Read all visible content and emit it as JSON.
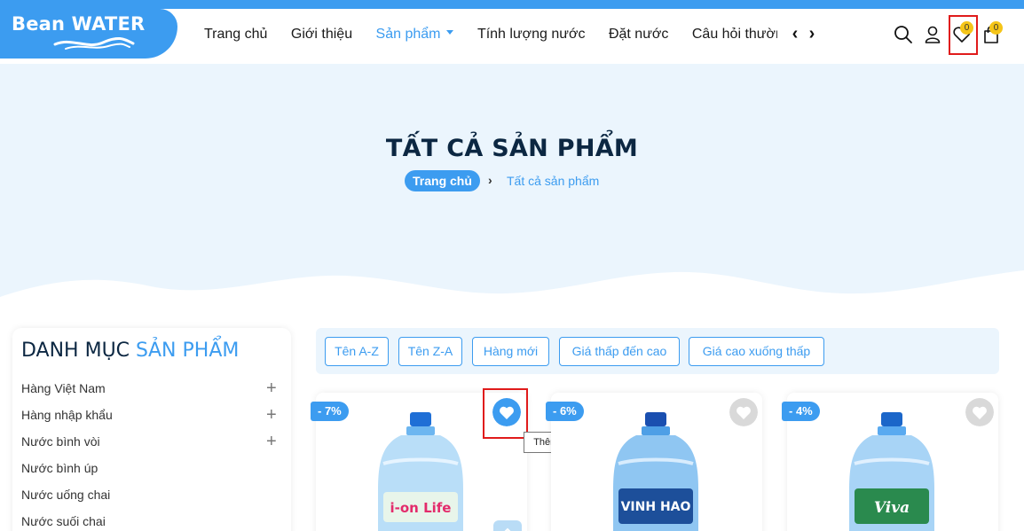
{
  "colors": {
    "accent": "#3c9cf0",
    "badge": "#f5c518",
    "highlight": "#e01b1b",
    "banner_bg": "#ebf5fd"
  },
  "logo": {
    "text": "Bean WATER"
  },
  "nav": {
    "items": [
      "Trang chủ",
      "Giới thiệu",
      "Sản phẩm",
      "Tính lượng nước",
      "Đặt nước",
      "Câu hỏi thường gặp"
    ],
    "active": "Sản phẩm",
    "prev_icon": "chevron-left-icon",
    "next_icon": "chevron-right-icon"
  },
  "header_icons": {
    "search": "search-icon",
    "account": "user-icon",
    "wishlist": "heart-icon",
    "wishlist_count": "0",
    "cart": "shopping-bag-icon",
    "cart_count": "0"
  },
  "banner": {
    "title": "TẤT CẢ SẢN PHẨM",
    "breadcrumb_home": "Trang chủ",
    "breadcrumb_sep": "›",
    "breadcrumb_current": "Tất cả sản phẩm"
  },
  "sidebar": {
    "title": "DANH MỤC",
    "title_accent": "SẢN PHẨM",
    "categories": [
      {
        "label": "Hàng Việt Nam",
        "expandable": true
      },
      {
        "label": "Hàng nhập khẩu",
        "expandable": true
      },
      {
        "label": "Nước bình vòi",
        "expandable": true
      },
      {
        "label": "Nước bình úp",
        "expandable": false
      },
      {
        "label": "Nước uống chai",
        "expandable": false
      },
      {
        "label": "Nước suối chai",
        "expandable": false
      }
    ],
    "expand_symbol": "+"
  },
  "sort": {
    "options": [
      "Tên A-Z",
      "Tên Z-A",
      "Hàng mới",
      "Giá thấp đến cao",
      "Giá cao xuống thấp"
    ]
  },
  "products": [
    {
      "discount": "- 7%",
      "brand_label": "i-on Life",
      "wishlist_active": true
    },
    {
      "discount": "- 6%",
      "brand_label": "VINH HAO",
      "wishlist_active": false
    },
    {
      "discount": "- 4%",
      "brand_label": "Viva",
      "wishlist_active": false
    }
  ],
  "tooltip": {
    "text": "Thêm vào yêu thích"
  }
}
